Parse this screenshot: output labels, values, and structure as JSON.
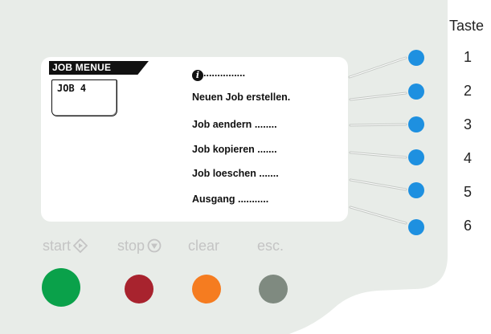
{
  "screen": {
    "menu_title": "JOB MENUE",
    "job_box": "JOB  4",
    "items": [
      {
        "label": "",
        "dots": "...............",
        "icon": "info-icon"
      },
      {
        "label": "Neuen Job erstellen.",
        "dots": ""
      },
      {
        "label": "Job aendern",
        "dots": "........"
      },
      {
        "label": "Job kopieren",
        "dots": "......."
      },
      {
        "label": "Job loeschen",
        "dots": "......."
      },
      {
        "label": "Ausgang",
        "dots": "..........."
      }
    ]
  },
  "taste": {
    "title": "Taste",
    "numbers": [
      "1",
      "2",
      "3",
      "4",
      "5",
      "6"
    ]
  },
  "controls": {
    "start_label": "start",
    "stop_label": "stop",
    "clear_label": "clear",
    "esc_label": "esc."
  },
  "colors": {
    "panel": "#e8ece8",
    "soft_button": "#1e90e0",
    "start": "#0aa14a",
    "stop": "#a8232e",
    "clear": "#f57c20",
    "esc": "#7f8a80"
  }
}
